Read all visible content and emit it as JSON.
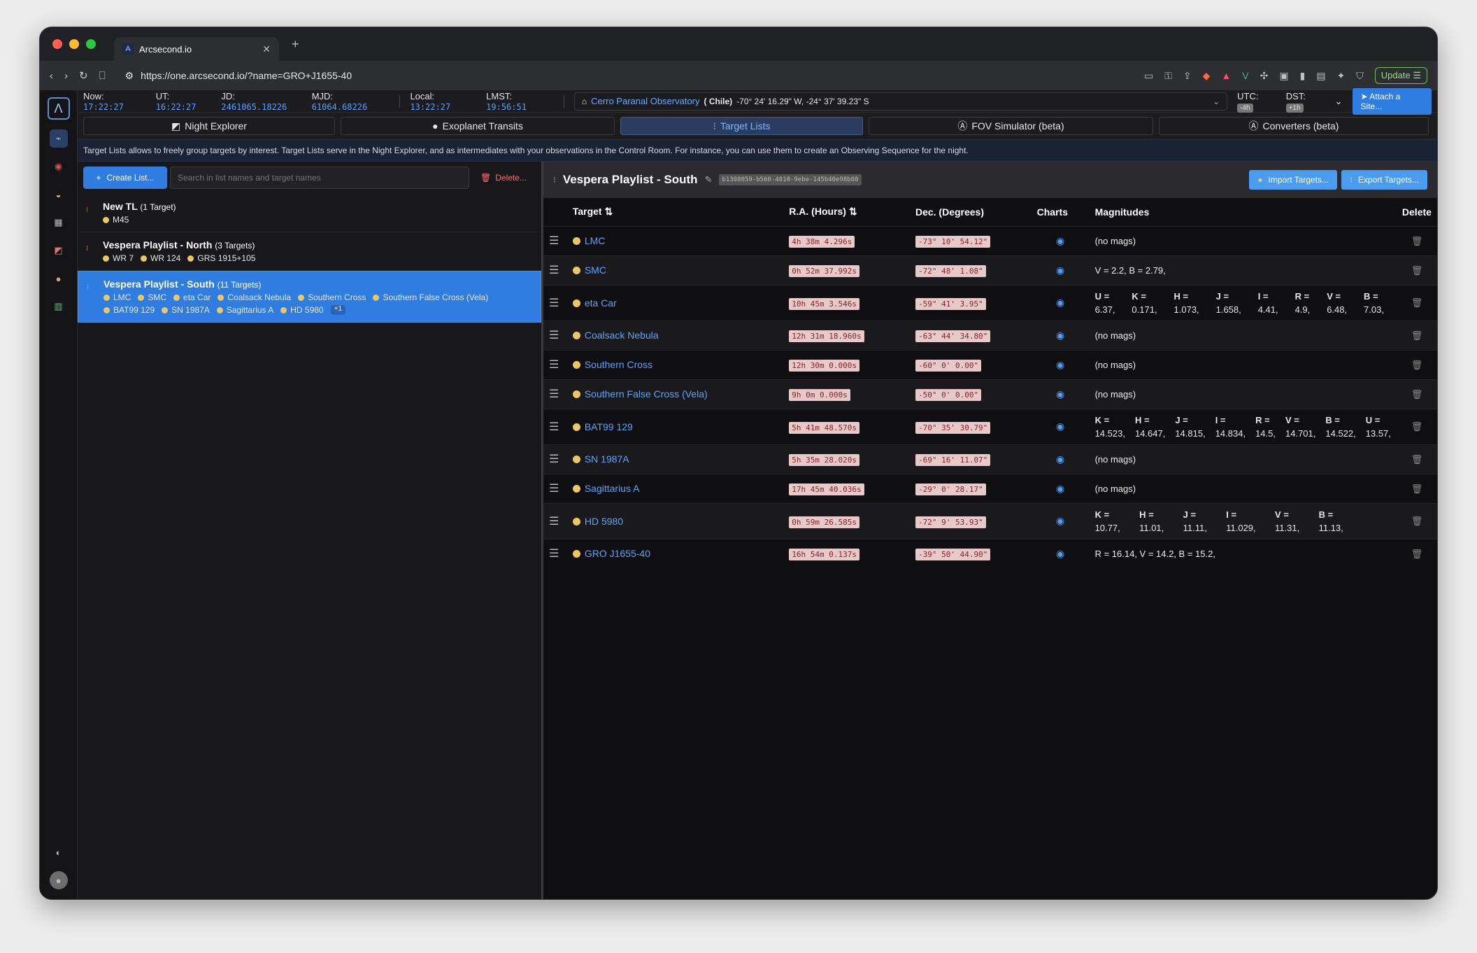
{
  "browser": {
    "tab_title": "Arcsecond.io",
    "url": "https://one.arcsecond.io/?name=GRO+J1655-40",
    "update_label": "Update"
  },
  "topbar": {
    "now_label": "Now:",
    "now": "17:22:27",
    "ut_label": "UT:",
    "ut": "16:22:27",
    "jd_label": "JD:",
    "jd": "2461065.18226",
    "mjd_label": "MJD:",
    "mjd": "61064.68226",
    "local_label": "Local:",
    "local": "13:22:27",
    "lmst_label": "LMST:",
    "lmst": "19:56:51",
    "site_name": "Cerro Paranal Observatory",
    "site_country": "( Chile)",
    "site_coords": "-70° 24' 16.29\" W, -24° 37' 39.23\" S",
    "utc_label": "UTC:",
    "utc_offset": "-4h",
    "dst_label": "DST:",
    "dst_offset": "+1h",
    "attach_label": "Attach a Site..."
  },
  "tabs": [
    {
      "label": "Night Explorer"
    },
    {
      "label": "Exoplanet Transits"
    },
    {
      "label": "Target Lists"
    },
    {
      "label": "FOV Simulator (beta)"
    },
    {
      "label": "Converters (beta)"
    }
  ],
  "info": "Target Lists allows to freely group targets by interest. Target Lists serve in the Night Explorer, and as intermediates with your observations in the Control Room. For instance, you can use them to create an Observing Sequence for the night.",
  "left": {
    "create_label": "Create List...",
    "search_placeholder": "Search in list names and target names",
    "delete_label": "Delete...",
    "lists": [
      {
        "name": "New TL",
        "count": "(1 Target)",
        "targets": [
          "M45"
        ]
      },
      {
        "name": "Vespera Playlist - North",
        "count": "(3 Targets)",
        "targets": [
          "WR 7",
          "WR 124",
          "GRS 1915+105"
        ]
      },
      {
        "name": "Vespera Playlist - South",
        "count": "(11 Targets)",
        "targets": [
          "LMC",
          "SMC",
          "eta Car",
          "Coalsack Nebula",
          "Southern Cross",
          "Southern False Cross (Vela)",
          "BAT99 129",
          "SN 1987A",
          "Sagittarius A",
          "HD 5980"
        ],
        "more": "+1"
      }
    ]
  },
  "right": {
    "title": "Vespera Playlist - South",
    "uuid": "b1308059-b560-4810-9ebe-145b40e98b08",
    "import_label": "Import Targets...",
    "export_label": "Export Targets...",
    "columns": {
      "target": "Target ⇅",
      "ra": "R.A. (Hours) ⇅",
      "dec": "Dec. (Degrees)",
      "charts": "Charts",
      "mags": "Magnitudes",
      "delete": "Delete"
    },
    "rows": [
      {
        "name": "LMC",
        "ra": "4h 38m 4.296s",
        "dec": "-73° 10' 54.12\"",
        "mags": "(no mags)"
      },
      {
        "name": "SMC",
        "ra": "0h 52m 37.992s",
        "dec": "-72° 48' 1.08\"",
        "mags": "V = 2.2,  B = 2.79,"
      },
      {
        "name": "eta Car",
        "ra": "10h 45m 3.546s",
        "dec": "-59° 41' 3.95\"",
        "mgrid": [
          [
            "U =",
            "6.37,"
          ],
          [
            "K =",
            "0.171,"
          ],
          [
            "H =",
            "1.073,"
          ],
          [
            "J =",
            "1.658,"
          ],
          [
            "I =",
            "4.41,"
          ],
          [
            "R =",
            "4.9,"
          ],
          [
            "V =",
            "6.48,"
          ],
          [
            "B =",
            "7.03,"
          ]
        ]
      },
      {
        "name": "Coalsack Nebula",
        "ra": "12h 31m 18.960s",
        "dec": "-63° 44' 34.80\"",
        "mags": "(no mags)"
      },
      {
        "name": "Southern Cross",
        "ra": "12h 30m 0.000s",
        "dec": "-60° 0' 0.00\"",
        "mags": "(no mags)"
      },
      {
        "name": "Southern False Cross (Vela)",
        "ra": "9h 0m 0.000s",
        "dec": "-50° 0' 0.00\"",
        "mags": "(no mags)"
      },
      {
        "name": "BAT99 129",
        "ra": "5h 41m 48.570s",
        "dec": "-70° 35' 30.79\"",
        "mgrid": [
          [
            "K =",
            "14.523,"
          ],
          [
            "H =",
            "14.647,"
          ],
          [
            "J =",
            "14.815,"
          ],
          [
            "I =",
            "14.834,"
          ],
          [
            "R =",
            "14.5,"
          ],
          [
            "V =",
            "14.701,"
          ],
          [
            "B =",
            "14.522,"
          ],
          [
            "U =",
            "13.57,"
          ]
        ]
      },
      {
        "name": "SN 1987A",
        "ra": "5h 35m 28.020s",
        "dec": "-69° 16' 11.07\"",
        "mags": "(no mags)"
      },
      {
        "name": "Sagittarius A",
        "ra": "17h 45m 40.036s",
        "dec": "-29° 0' 28.17\"",
        "mags": "(no mags)"
      },
      {
        "name": "HD 5980",
        "ra": "0h 59m 26.585s",
        "dec": "-72° 9' 53.93\"",
        "mgrid": [
          [
            "K =",
            "10.77,"
          ],
          [
            "H =",
            "11.01,"
          ],
          [
            "J =",
            "11.11,"
          ],
          [
            "I =",
            "11.029,"
          ],
          [
            "V =",
            "11.31,"
          ],
          [
            "B =",
            "11.13,"
          ]
        ]
      },
      {
        "name": "GRO J1655-40",
        "ra": "16h 54m 0.137s",
        "dec": "-39° 50' 44.90\"",
        "mags": "R = 16.14,  V = 14.2,  B = 15.2,"
      }
    ]
  }
}
